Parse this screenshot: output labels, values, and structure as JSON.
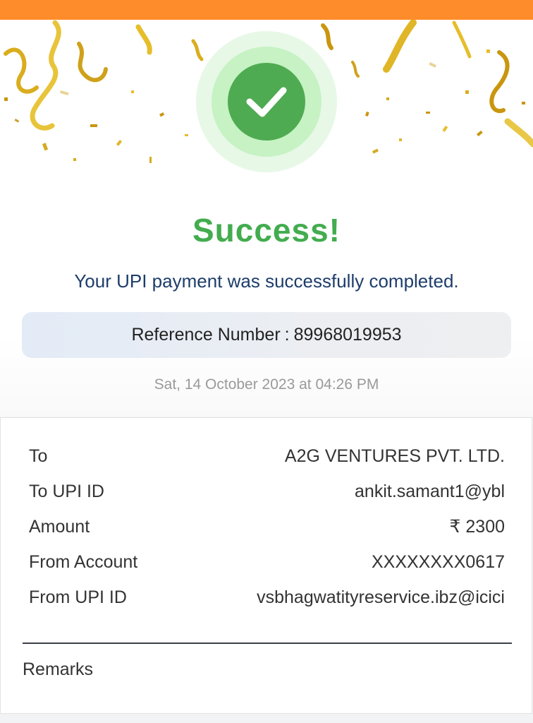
{
  "colors": {
    "top_bar": "#ff8c2a",
    "success_green": "#43ac4f",
    "subtitle_navy": "#1d3d6b",
    "confetti_gold": "#e6be2a"
  },
  "status": {
    "icon": "checkmark-icon",
    "title": "Success!",
    "message": "Your UPI payment was successfully completed."
  },
  "reference": {
    "label": "Reference Number",
    "separator": ":",
    "number": "89968019953"
  },
  "timestamp": "Sat, 14 October 2023 at 04:26 PM",
  "details": {
    "rows": [
      {
        "label": "To",
        "value": "A2G VENTURES PVT. LTD."
      },
      {
        "label": "To UPI ID",
        "value": "ankit.samant1@ybl"
      },
      {
        "label": "Amount",
        "value": "₹ 2300"
      },
      {
        "label": "From Account",
        "value": "XXXXXXXX0617"
      },
      {
        "label": "From UPI ID",
        "value": "vsbhagwatityreservice.ibz@icici"
      }
    ],
    "remarks_label": "Remarks"
  }
}
